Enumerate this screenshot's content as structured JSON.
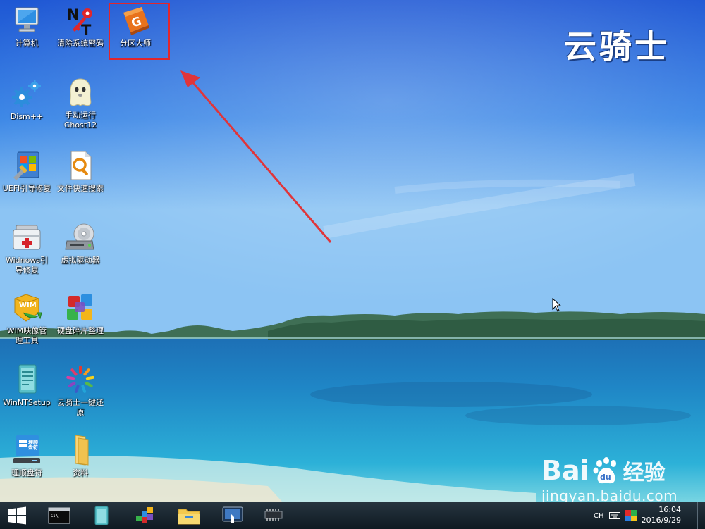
{
  "brand": {
    "name": "云骑士"
  },
  "desktop": {
    "icons": [
      {
        "id": "computer",
        "label": "计算机",
        "icon": "computer-icon"
      },
      {
        "id": "clear-password",
        "label": "清除系统密码",
        "icon": "ntpwd-key-icon"
      },
      {
        "id": "diskgenius",
        "label": "分区大师",
        "icon": "diskgenius-icon"
      },
      {
        "id": "dism",
        "label": "Dism++",
        "icon": "gears-icon"
      },
      {
        "id": "ghost",
        "label": "手动运行\nGhost12",
        "icon": "ghost-icon"
      },
      {
        "id": "uefi-repair",
        "label": "UEFI引导修复",
        "icon": "uefi-repair-icon"
      },
      {
        "id": "file-search",
        "label": "文件快速搜索",
        "icon": "file-search-icon"
      },
      {
        "id": "win-boot-repair",
        "label": "Widnows引\n导修复",
        "icon": "toolbox-icon"
      },
      {
        "id": "virtual-drive",
        "label": "虚拟驱动器",
        "icon": "virtual-drive-icon"
      },
      {
        "id": "wim-manager",
        "label": "WIM映像管\n理工具",
        "icon": "wim-icon"
      },
      {
        "id": "defrag",
        "label": "硬盘碎片整理",
        "icon": "defrag-icon"
      },
      {
        "id": "winntsetup",
        "label": "WinNTSetup",
        "icon": "winntsetup-icon"
      },
      {
        "id": "one-key-restore",
        "label": "云骑士一键还\n原",
        "icon": "restore-icon"
      },
      {
        "id": "drive-letter",
        "label": "理顺盘符",
        "icon": "drive-letter-icon"
      },
      {
        "id": "data",
        "label": "资料",
        "icon": "folder-icon"
      }
    ]
  },
  "drive_letter_badge": "理顺\n盘符",
  "wim_badge": "WIM",
  "watermark": {
    "logo_left": "Bai",
    "logo_right": "经验",
    "du_char": "du",
    "url": "jingyan.baidu.com"
  },
  "taskbar": {
    "buttons": [
      "start-icon",
      "cmd-icon",
      "winntsetup-icon",
      "defrag-icon",
      "file-explorer-icon",
      "touch-screen-icon",
      "chip-icon"
    ],
    "tray": {
      "ime": "CH",
      "time": "16:04",
      "date": "2016/9/29"
    }
  },
  "colors": {
    "highlight_box": "#e2262c",
    "arrow": "#e0353a"
  }
}
